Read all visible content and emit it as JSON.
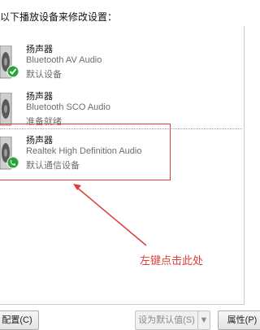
{
  "instruction": "以下播放设备来修改设置：",
  "devices": [
    {
      "name": "扬声器",
      "description": "Bluetooth AV Audio",
      "status": "默认设备",
      "badge": "green-check-icon"
    },
    {
      "name": "扬声器",
      "description": "Bluetooth SCO Audio",
      "status": "准备就绪",
      "badge": ""
    },
    {
      "name": "扬声器",
      "description": "Realtek High Definition Audio",
      "status": "默认通信设备",
      "badge": "green-phone-icon"
    }
  ],
  "annotation": "左键点击此处",
  "buttons": {
    "configure": "配置(C)",
    "set_default": "设为默认值(S)",
    "dropdown": "▼",
    "properties": "属性(P)"
  },
  "colors": {
    "highlight": "#e23c3c",
    "badge_green": "#2aa43a"
  }
}
